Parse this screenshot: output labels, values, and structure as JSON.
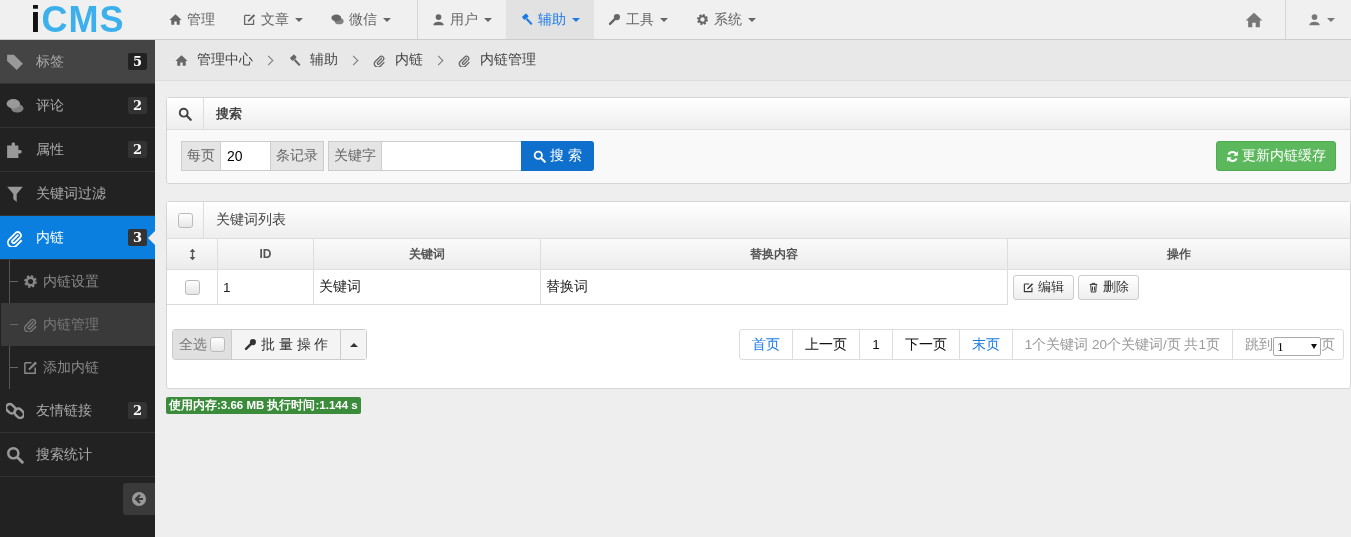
{
  "brand": {
    "logo_accent": "i",
    "logo": "CMS"
  },
  "top_nav": [
    {
      "label": "管理",
      "dropdown": false,
      "selected": false,
      "divider_before": false
    },
    {
      "label": "文章",
      "dropdown": true,
      "selected": false,
      "divider_before": false
    },
    {
      "label": "微信",
      "dropdown": true,
      "selected": false,
      "divider_before": false
    },
    {
      "label": "用户",
      "dropdown": true,
      "selected": false,
      "divider_before": true
    },
    {
      "label": "辅助",
      "dropdown": true,
      "selected": true,
      "divider_before": false
    },
    {
      "label": "工具",
      "dropdown": true,
      "selected": false,
      "divider_before": false
    },
    {
      "label": "系统",
      "dropdown": true,
      "selected": false,
      "divider_before": false
    }
  ],
  "sidebar": {
    "items": [
      {
        "label": "标签",
        "badge": "5",
        "selected": false,
        "hovered": true
      },
      {
        "label": "评论",
        "badge": "2",
        "selected": false,
        "hovered": false
      },
      {
        "label": "属性",
        "badge": "2",
        "selected": false,
        "hovered": false
      },
      {
        "label": "关键词过滤",
        "selected": false,
        "hovered": false
      },
      {
        "label": "内链",
        "badge": "3",
        "selected": true,
        "hovered": false,
        "children": [
          {
            "label": "内链设置",
            "selected": false
          },
          {
            "label": "内链管理",
            "selected": true
          },
          {
            "label": "添加内链",
            "selected": false
          }
        ]
      },
      {
        "label": "友情链接",
        "badge": "2",
        "selected": false,
        "hovered": false
      },
      {
        "label": "搜索统计",
        "selected": false,
        "hovered": false
      }
    ]
  },
  "breadcrumb": [
    "管理中心",
    "辅助",
    "内链",
    "内链管理"
  ],
  "search": {
    "title": "搜索",
    "per_page_prefix": "每页",
    "per_page": "20",
    "per_page_suffix": "条记录",
    "keyword_label": "关键字",
    "button": "搜 索",
    "refresh_button": "更新内链缓存"
  },
  "list": {
    "title": "关键词列表",
    "header_checked": false,
    "columns": [
      "ID",
      "关键词",
      "替换内容",
      "操作"
    ],
    "rows": [
      {
        "checked": false,
        "id": "1",
        "keyword": "关键词",
        "replacement": "替换词",
        "actions": [
          "编辑",
          "删除"
        ]
      }
    ],
    "select_all_label": "全选",
    "select_all_checked": false,
    "batch_button": "批 量 操 作",
    "pagination": {
      "links": [
        {
          "label": "首页",
          "kind": "link"
        },
        {
          "label": "上一页",
          "kind": "plain"
        },
        {
          "label": "1",
          "kind": "plain"
        },
        {
          "label": "下一页",
          "kind": "plain"
        },
        {
          "label": "末页",
          "kind": "link"
        }
      ],
      "info": "1个关键词 20个关键词/页 共1页",
      "jump_label": "跳到",
      "jump_value": "1",
      "jump_suffix": "页"
    }
  },
  "footer": {
    "stats": "使用内存:3.66 MB 执行时间:1.144 s"
  }
}
